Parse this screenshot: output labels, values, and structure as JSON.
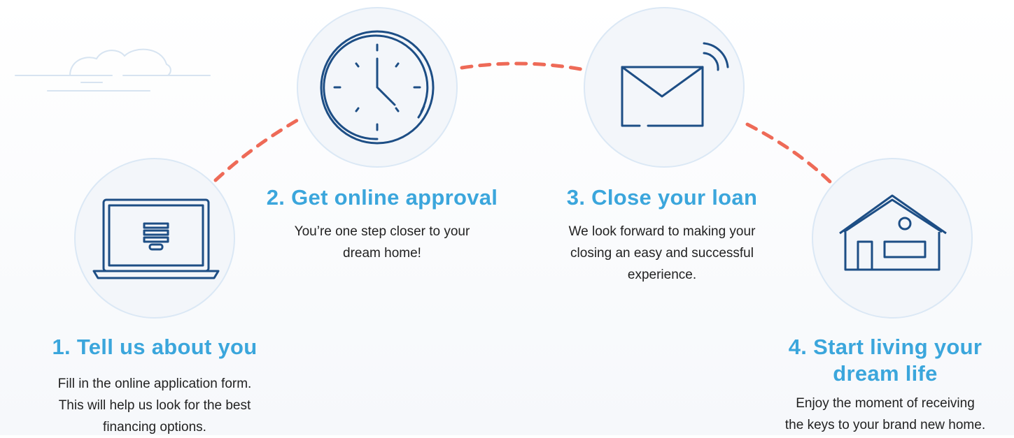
{
  "steps": [
    {
      "icon": "laptop-form-icon",
      "title": "1. Tell us about you",
      "desc_lines": [
        "Fill in the online application form.",
        "This will help us look for the best",
        "financing options."
      ]
    },
    {
      "icon": "clock-icon",
      "title": "2. Get online approval",
      "desc_lines": [
        "You’re one step closer to your",
        "dream home!"
      ]
    },
    {
      "icon": "envelope-signal-icon",
      "title": "3. Close your loan",
      "desc_lines": [
        "We look forward to making your",
        "closing an easy and successful",
        "experience."
      ]
    },
    {
      "icon": "house-icon",
      "title_lines": [
        "4. Start living your",
        "dream life"
      ],
      "desc_lines": [
        "Enjoy the moment of receiving",
        "the keys to your brand new home."
      ]
    }
  ],
  "colors": {
    "accent": "#3ba6dc",
    "icon": "#1d4e85",
    "dash": "#ee6a57",
    "circle_fill": "#f3f6fa",
    "circle_border": "#dbe8f5"
  }
}
